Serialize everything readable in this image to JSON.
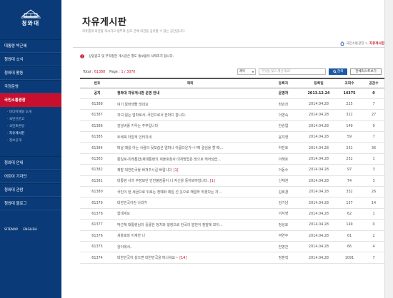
{
  "sidebar": {
    "logo_text": "청와대",
    "logo_small_text": "대한민국",
    "nav_items": [
      {
        "label": "대통령 박근혜",
        "active": false
      },
      {
        "label": "청와대 소식",
        "active": false
      },
      {
        "label": "청와대 활동",
        "active": false
      },
      {
        "label": "국정운영",
        "active": false
      },
      {
        "label": "국민소통광장",
        "active": true
      }
    ],
    "sub_items": [
      {
        "label": "미디어채널 소개",
        "current": false
      },
      {
        "label": "국민신문고",
        "current": false
      },
      {
        "label": "국민토론방",
        "current": false
      },
      {
        "label": "자유게시판",
        "current": true
      },
      {
        "label": "정보공개",
        "current": false
      }
    ],
    "nav_lower": [
      {
        "label": "청와대 안내"
      },
      {
        "label": "어린이 기자단"
      },
      {
        "label": "청와대 관람"
      },
      {
        "label": "청와대 블로그"
      }
    ],
    "footer_links": [
      "SITEMAP",
      "ENGLISH"
    ]
  },
  "header": {
    "title": "자유게시판",
    "description": "자유롭게 의견을 게시하고 정부와 상호 간에 의견을 공유할 수 있는 공간입니다.",
    "breadcrumb_section": "국민소통광장 >",
    "breadcrumb_current": "자유게시판"
  },
  "notice_text": "상업광고 및 부적절한 게시글은 별도 통보없이 삭제조치 됩니다.",
  "toolbar": {
    "total_label": "Total :",
    "total_value": "61388",
    "page_label": "Page :",
    "page_value": "1 / 3070",
    "search_select": "제목",
    "search_placeholder": "무엇을 찾고 계신가요?",
    "search_button": "검색",
    "all_list_button": "전체리스트보기"
  },
  "table": {
    "headers": [
      "번호",
      "제목",
      "등록자",
      "등록일",
      "조회수",
      "공감수"
    ],
    "rows": [
      {
        "num": "공지",
        "title": "청와대 자유게시판 운영 안내",
        "comments": "",
        "writer": "운영자",
        "date": "2013.12.24",
        "views": "14375",
        "likes": "0",
        "notice": true
      },
      {
        "num": "61388",
        "title": "여기 알바생들 많네요",
        "comments": "",
        "writer": "최민진",
        "date": "2014.04.28",
        "views": "225",
        "likes": "7",
        "notice": false
      },
      {
        "num": "61387",
        "title": "자녀 잃는 엄마로서..국민으로서 한마디 합니다.",
        "comments": "",
        "writer": "이영숙",
        "date": "2014.04.28",
        "views": "322",
        "likes": "27",
        "notice": false
      },
      {
        "num": "61386",
        "title": "감남버풀 키우는 주무입니다",
        "comments": "",
        "writer": "한승엽",
        "date": "2014.04.28",
        "views": "149",
        "likes": "9",
        "notice": false
      },
      {
        "num": "61385",
        "title": "트레픽 더합게 인터지네",
        "comments": "",
        "writer": "윤지영",
        "date": "2014.04.28",
        "views": "59",
        "likes": "7",
        "notice": false
      },
      {
        "num": "61384",
        "title": "떠날 때를 아는 사람의 뒷모습은 얼마나 아름다운가~!!예 결심을 할 때…",
        "comments": "",
        "writer": "하진호",
        "date": "2014.04.28",
        "views": "231",
        "likes": "36",
        "notice": false
      },
      {
        "num": "61383",
        "title": "통일로-미래통합(제대통령의 세울호참사 대처방법은 정으로 뛰어넘습…",
        "comments": "",
        "writer": "이해호",
        "date": "2014.04.28",
        "views": "252",
        "likes": "1",
        "notice": false
      },
      {
        "num": "61382",
        "title": "제발 대한민국을 바쳐주시길 바랍니다",
        "comments": "[1]",
        "writer": "이동수",
        "date": "2014.04.28",
        "views": "97",
        "likes": "3",
        "notice": false
      },
      {
        "num": "61381",
        "title": "대통령 사과 주장보단 안전불감증이 나 자신을 돌아봐야합니다.",
        "comments": "[1]",
        "writer": "신재권",
        "date": "2014.04.28",
        "views": "74",
        "likes": "3",
        "notice": false
      },
      {
        "num": "61380",
        "title": "국민이 낸 세금으로 뒤로는 정예화 제일 선 웃으로 해결하 하겠다는 자…",
        "comments": "",
        "writer": "김희경",
        "date": "2014.04.28",
        "views": "332",
        "likes": "26",
        "notice": false
      },
      {
        "num": "61379",
        "title": "대한민국이란 나라가",
        "comments": "",
        "writer": "김기남",
        "date": "2014.04.28",
        "views": "157",
        "likes": "14",
        "notice": false
      },
      {
        "num": "61378",
        "title": "합네세요",
        "comments": "",
        "writer": "이지영",
        "date": "2014.04.28",
        "views": "62",
        "likes": "1",
        "notice": false
      },
      {
        "num": "61377",
        "title": "박근혜 대통령님의 훌륭한 정치와 행정으로 한국의 발전이 정말에 보이…",
        "comments": "",
        "writer": "정성호",
        "date": "2014.04.28",
        "views": "149",
        "likes": "0",
        "notice": false
      },
      {
        "num": "61376",
        "title": "세울호와 이계한 나",
        "comments": "",
        "writer": "여연주",
        "date": "2014.04.28",
        "views": "61",
        "likes": "2",
        "notice": false
      },
      {
        "num": "61375",
        "title": "왕이에서..",
        "comments": "",
        "writer": "전병진",
        "date": "2014.04.28",
        "views": "66",
        "likes": "4",
        "notice": false
      },
      {
        "num": "61374",
        "title": "대한민국이 살으면 대한민국을 떠나세요~",
        "comments": "[14]",
        "writer": "정훈직",
        "date": "2014.04.28",
        "views": "1091",
        "likes": "7",
        "notice": false
      }
    ]
  },
  "colors": {
    "sidebar": "#0a3b78",
    "accent_red": "#c8102e",
    "search_button": "#1c5aa6"
  },
  "icons": [
    "crest-icon",
    "home-icon",
    "alert-icon",
    "caret-down-icon",
    "magnifier-icon"
  ]
}
